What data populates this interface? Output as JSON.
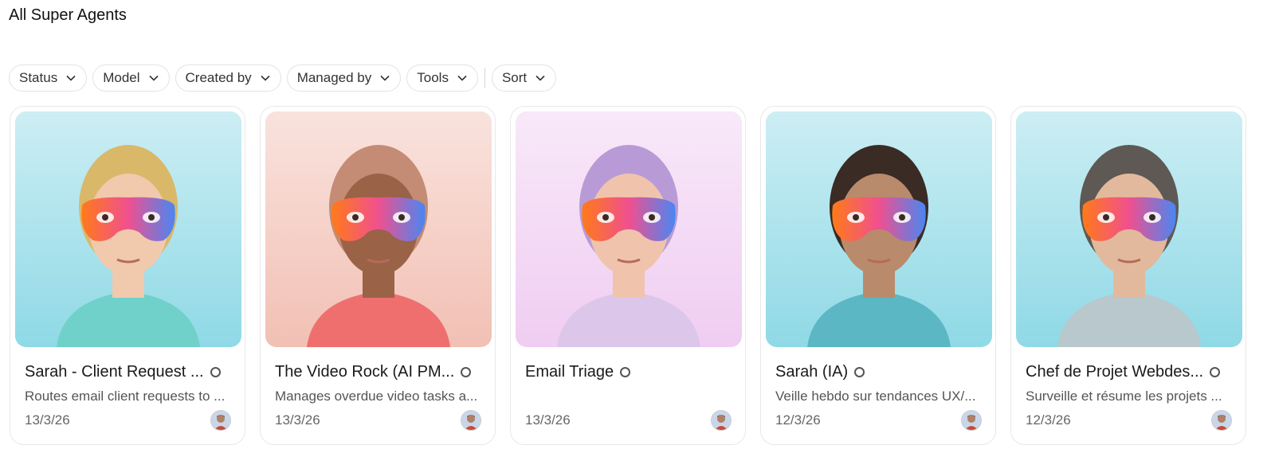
{
  "page": {
    "title": "All Super Agents"
  },
  "filters": [
    {
      "label": "Status"
    },
    {
      "label": "Model"
    },
    {
      "label": "Created by"
    },
    {
      "label": "Managed by"
    },
    {
      "label": "Tools"
    }
  ],
  "sort": {
    "label": "Sort"
  },
  "agents": [
    {
      "name": "Sarah - Client Request ...",
      "description": "Routes email client requests to ...",
      "date": "13/3/26",
      "bg": "#8fd9e6",
      "skin": "#f1c9ad",
      "hair": "#d9b86a",
      "top": "#6fd1c9"
    },
    {
      "name": "The Video Rock (AI PM...",
      "description": "Manages overdue video tasks a...",
      "date": "13/3/26",
      "bg": "#f2c0b4",
      "skin": "#9a6247",
      "hair": "#c48c74",
      "top": "#ef6f6f"
    },
    {
      "name": "Email Triage",
      "description": "",
      "date": "13/3/26",
      "bg": "#f0cdf2",
      "skin": "#f0c4ac",
      "hair": "#b89bd6",
      "top": "#dcc6ea"
    },
    {
      "name": "Sarah (IA)",
      "description": "Veille hebdo sur tendances UX/...",
      "date": "12/3/26",
      "bg": "#8fd9e6",
      "skin": "#b98a6c",
      "hair": "#3a2b24",
      "top": "#5bb7c4"
    },
    {
      "name": "Chef de Projet Webdes...",
      "description": "Surveille et résume les projets ...",
      "date": "12/3/26",
      "bg": "#8fd9e6",
      "skin": "#e2b99d",
      "hair": "#5e5954",
      "top": "#b8c8cc"
    }
  ]
}
